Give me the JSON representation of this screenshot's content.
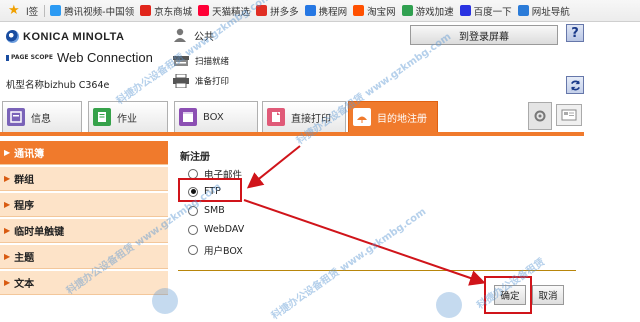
{
  "bookmarks": {
    "items": [
      {
        "label": "l签",
        "color": "#888888"
      },
      {
        "label": "腾讯视频-中国领",
        "color": "#2b9af3"
      },
      {
        "label": "京东商城",
        "color": "#e1251b"
      },
      {
        "label": "天猫精选",
        "color": "#ff0036"
      },
      {
        "label": "拼多多",
        "color": "#e02e24"
      },
      {
        "label": "携程网",
        "color": "#2577e3"
      },
      {
        "label": "淘宝网",
        "color": "#ff5000"
      },
      {
        "label": "游戏加速",
        "color": "#30a050"
      },
      {
        "label": "百度一下",
        "color": "#2932e1"
      },
      {
        "label": "网址导航",
        "color": "#2b7bd8"
      }
    ]
  },
  "header": {
    "brand": "KONICA MINOLTA",
    "pagescope": "PAGE SCOPE",
    "product": "Web Connection",
    "model": "机型名称bizhub C364e",
    "user": "公共",
    "login_button": "到登录屏幕",
    "help_button": "?",
    "scan_status": "扫描就绪",
    "print_status": "准备打印"
  },
  "tabs": [
    {
      "label": "信息",
      "icon": "info-icon",
      "active": false
    },
    {
      "label": "作业",
      "icon": "job-icon",
      "active": false
    },
    {
      "label": "BOX",
      "icon": "box-icon",
      "active": false
    },
    {
      "label": "直接打印",
      "icon": "direct-print-icon",
      "active": false
    },
    {
      "label": "目的地注册",
      "icon": "destination-icon",
      "active": true
    }
  ],
  "sidebar": {
    "items": [
      {
        "label": "通讯簿",
        "active": true
      },
      {
        "label": "群组",
        "active": false
      },
      {
        "label": "程序",
        "active": false
      },
      {
        "label": "临时单触键",
        "active": false
      },
      {
        "label": "主题",
        "active": false
      },
      {
        "label": "文本",
        "active": false
      }
    ]
  },
  "main": {
    "title": "新注册",
    "options": [
      {
        "label": "电子邮件",
        "selected": false
      },
      {
        "label": "FTP",
        "selected": true
      },
      {
        "label": "SMB",
        "selected": false
      },
      {
        "label": "WebDAV",
        "selected": false
      },
      {
        "label": "用户BOX",
        "selected": false
      }
    ],
    "ok_button": "确定",
    "cancel_button": "取消"
  },
  "watermark": {
    "text_cn": "科捷办公设备租赁",
    "text_url": "www.gzkmbg.com",
    "badge": "km"
  },
  "colors": {
    "accent": "#f07a2c",
    "sidebar_bg": "#fde3c8",
    "annotation_red": "#d0141a"
  }
}
